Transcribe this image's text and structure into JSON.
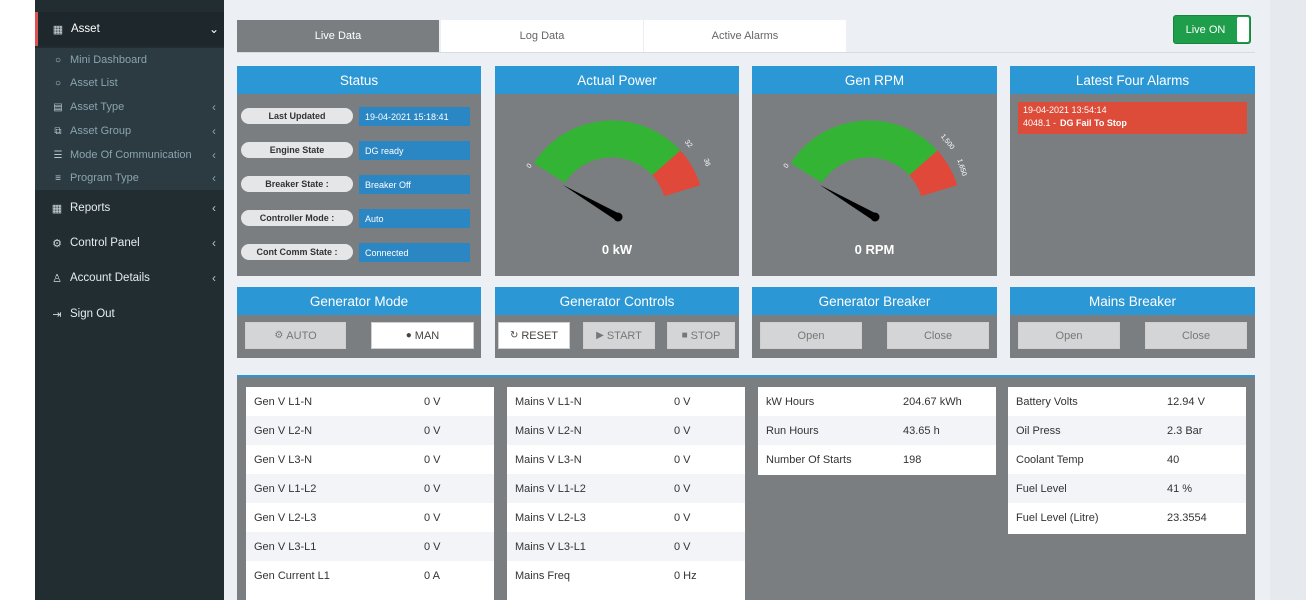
{
  "sidebar": {
    "asset": {
      "label": "Asset"
    },
    "sub_items": [
      {
        "label": "Mini Dashboard"
      },
      {
        "label": "Asset List"
      },
      {
        "label": "Asset Type"
      },
      {
        "label": "Asset Group"
      },
      {
        "label": "Mode Of Communication"
      },
      {
        "label": "Program Type"
      }
    ],
    "main_items": [
      {
        "label": "Reports"
      },
      {
        "label": "Control Panel"
      },
      {
        "label": "Account Details"
      },
      {
        "label": "Sign Out"
      }
    ]
  },
  "tabs": [
    {
      "label": "Live Data",
      "active": true
    },
    {
      "label": "Log Data",
      "active": false
    },
    {
      "label": "Active Alarms",
      "active": false
    }
  ],
  "live_toggle": {
    "label": "Live ON",
    "on": true
  },
  "status": {
    "title": "Status",
    "rows": [
      {
        "label": "Last Updated",
        "value": "19-04-2021 15:18:41"
      },
      {
        "label": "Engine State",
        "value": "DG ready"
      },
      {
        "label": "Breaker State :",
        "value": "Breaker Off"
      },
      {
        "label": "Controller Mode :",
        "value": "Auto"
      },
      {
        "label": "Cont Comm State :",
        "value": "Connected"
      }
    ]
  },
  "actual_power": {
    "title": "Actual Power",
    "min_label": "0",
    "red_start_label": "32",
    "max_label": "36",
    "value_text": "0 kW",
    "value": 0
  },
  "gen_rpm": {
    "title": "Gen RPM",
    "min_label": "0",
    "red_start_label": "1,500",
    "max_label": "1,650",
    "value_text": "0 RPM",
    "value": 0
  },
  "alarms": {
    "title": "Latest Four Alarms",
    "items": [
      {
        "time": "19-04-2021 13:54:14",
        "code": "4048.1 -",
        "message": "DG Fail To Stop"
      }
    ]
  },
  "generator_mode": {
    "title": "Generator Mode",
    "auto_label": "AUTO",
    "man_label": "MAN"
  },
  "generator_controls": {
    "title": "Generator Controls",
    "reset_label": "RESET",
    "start_label": "START",
    "stop_label": "STOP"
  },
  "generator_breaker": {
    "title": "Generator Breaker",
    "open_label": "Open",
    "close_label": "Close"
  },
  "mains_breaker": {
    "title": "Mains Breaker",
    "open_label": "Open",
    "close_label": "Close"
  },
  "tables": {
    "gen": [
      {
        "k": "Gen V L1-N",
        "v": "0 V"
      },
      {
        "k": "Gen V L2-N",
        "v": "0 V"
      },
      {
        "k": "Gen V L3-N",
        "v": "0 V"
      },
      {
        "k": "Gen V L1-L2",
        "v": "0 V"
      },
      {
        "k": "Gen V L2-L3",
        "v": "0 V"
      },
      {
        "k": "Gen V L3-L1",
        "v": "0 V"
      },
      {
        "k": "Gen Current L1",
        "v": "0 A"
      }
    ],
    "mains": [
      {
        "k": "Mains V L1-N",
        "v": "0 V"
      },
      {
        "k": "Mains V L2-N",
        "v": "0 V"
      },
      {
        "k": "Mains V L3-N",
        "v": "0 V"
      },
      {
        "k": "Mains V L1-L2",
        "v": "0 V"
      },
      {
        "k": "Mains V L2-L3",
        "v": "0 V"
      },
      {
        "k": "Mains V L3-L1",
        "v": "0 V"
      },
      {
        "k": "Mains Freq",
        "v": "0 Hz"
      }
    ],
    "counters": [
      {
        "k": "kW Hours",
        "v": "204.67 kWh"
      },
      {
        "k": "Run Hours",
        "v": "43.65 h"
      },
      {
        "k": "Number Of Starts",
        "v": "198"
      }
    ],
    "engine": [
      {
        "k": "Battery Volts",
        "v": "12.94 V"
      },
      {
        "k": "Oil Press",
        "v": "2.3 Bar"
      },
      {
        "k": "Coolant Temp",
        "v": "40"
      },
      {
        "k": "Fuel Level",
        "v": "41 %"
      },
      {
        "k": "Fuel Level (Litre)",
        "v": "23.3554"
      }
    ]
  },
  "colors": {
    "accent": "#2b97d4",
    "gauge_green": "#34b434",
    "gauge_red": "#e0483a",
    "alarm_red": "#dd4b39",
    "live_green": "#1e9e4a"
  }
}
